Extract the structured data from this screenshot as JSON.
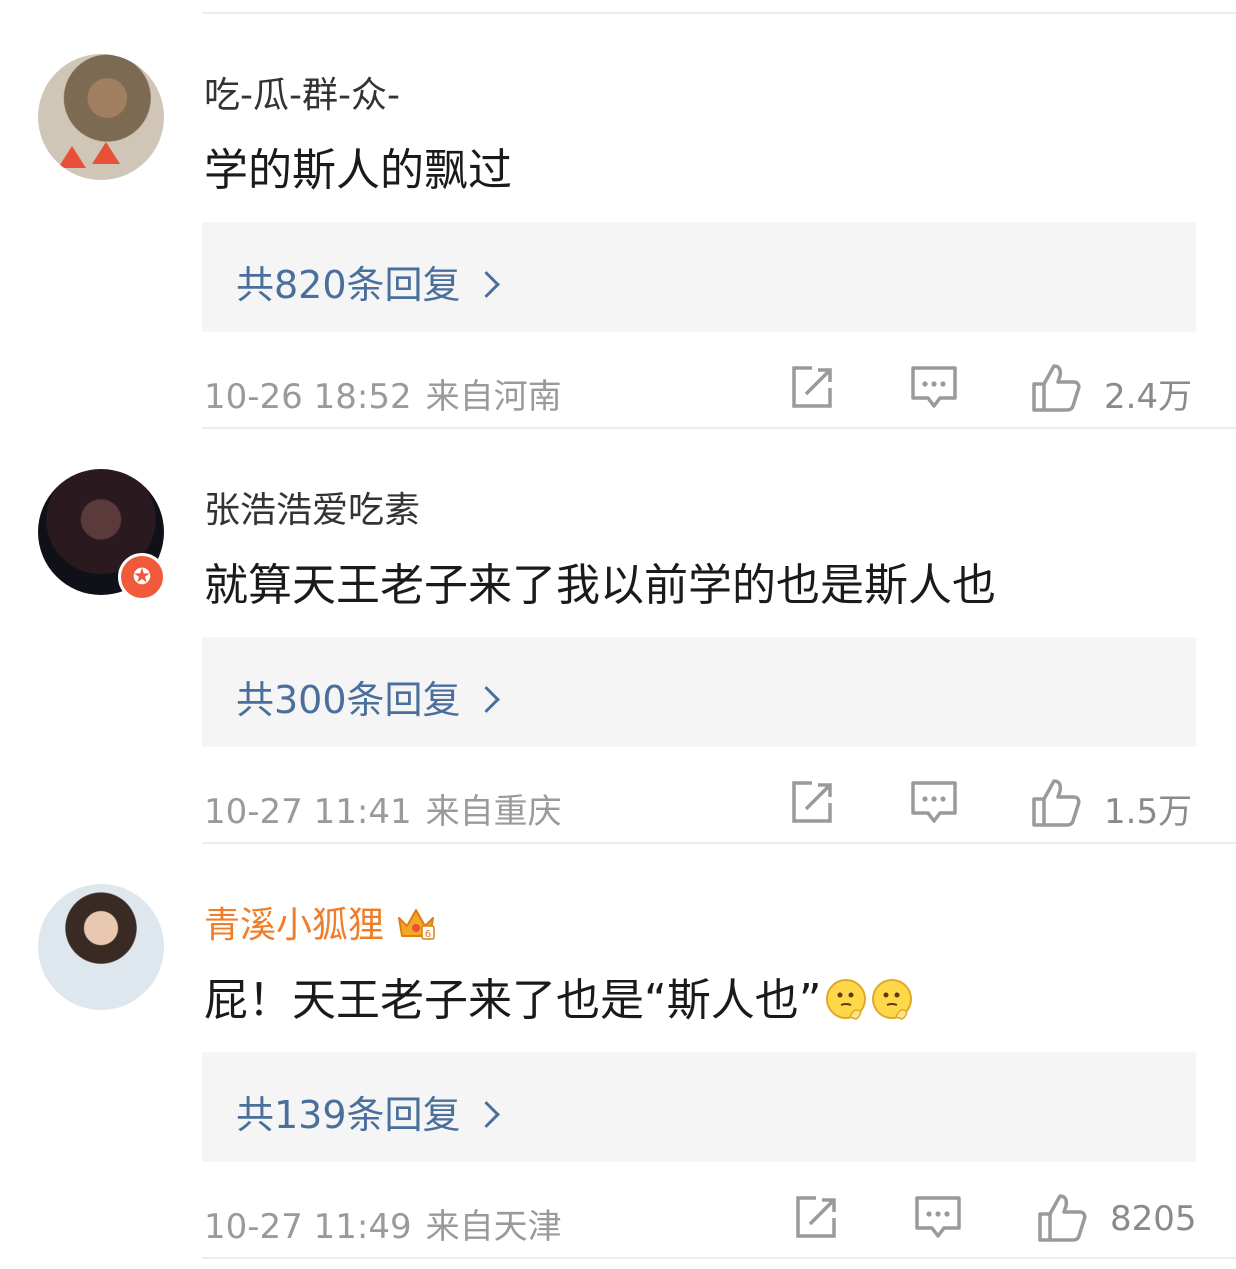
{
  "comments": [
    {
      "username": "吃-瓜-群-众-",
      "text": "学的斯人的飘过",
      "replies_label": "共820条回复",
      "time": "10-26 18:52",
      "location": "来自河南",
      "likes": "2.4万"
    },
    {
      "username": "张浩浩爱吃素",
      "text": "就算天王老子来了我以前学的也是斯人也",
      "replies_label": "共300条回复",
      "time": "10-27 11:41",
      "location": "来自重庆",
      "likes": "1.5万"
    },
    {
      "username": "青溪小狐狸",
      "text": "屁！天王老子来了也是“斯人也”",
      "replies_label": "共139条回复",
      "time": "10-27 11:49",
      "location": "来自天津",
      "likes": "8205"
    }
  ],
  "icons": {
    "repost": "repost-icon",
    "comment": "comment-icon",
    "like": "like-icon",
    "vip": "crown-icon",
    "verified": "star-badge-icon",
    "emoji": "thinking-emoji-icon"
  },
  "colors": {
    "link": "#4a6f9c",
    "vip_name": "#f07d2a",
    "meta": "#9a9a9a",
    "reply_bg": "#f5f5f5"
  }
}
